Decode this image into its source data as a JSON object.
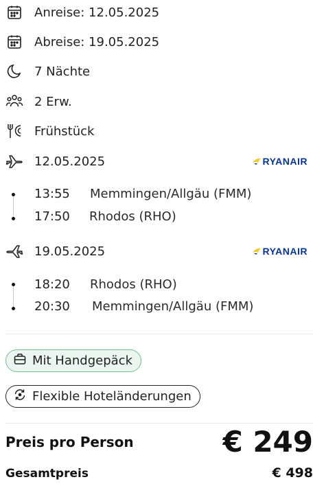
{
  "details": {
    "arrival": "Anreise: 12.05.2025",
    "departure": "Abreise: 19.05.2025",
    "nights": "7 Nächte",
    "travelers": "2 Erw.",
    "board": "Frühstück"
  },
  "outbound": {
    "date": "12.05.2025",
    "airline": "RYANAIR",
    "dep_time": "13:55",
    "dep_place": "Memmingen/Allgäu (FMM)",
    "arr_time": "17:50",
    "arr_place": "Rhodos (RHO)"
  },
  "return": {
    "date": "19.05.2025",
    "airline": "RYANAIR",
    "dep_time": "18:20",
    "dep_place": "Rhodos (RHO)",
    "arr_time": "20:30",
    "arr_place": "Memmingen/Allgäu (FMM)"
  },
  "tags": {
    "baggage": "Mit Handgepäck",
    "flexible": "Flexible Hoteländerungen"
  },
  "pricing": {
    "per_person_label": "Preis pro Person",
    "per_person_value": "€ 249",
    "total_label": "Gesamtpreis",
    "total_value": "€ 498"
  },
  "colors": {
    "ryanair_blue": "#073590",
    "ryanair_gold": "#f1c933",
    "pill_green_bg": "#eaf6ef",
    "pill_green_border": "#79b98f"
  },
  "icons": [
    "calendar-icon",
    "moon-icon",
    "people-icon",
    "cutlery-icon",
    "plane-departure-icon",
    "plane-arrival-icon",
    "harp-icon",
    "luggage-icon",
    "refresh-icon"
  ]
}
